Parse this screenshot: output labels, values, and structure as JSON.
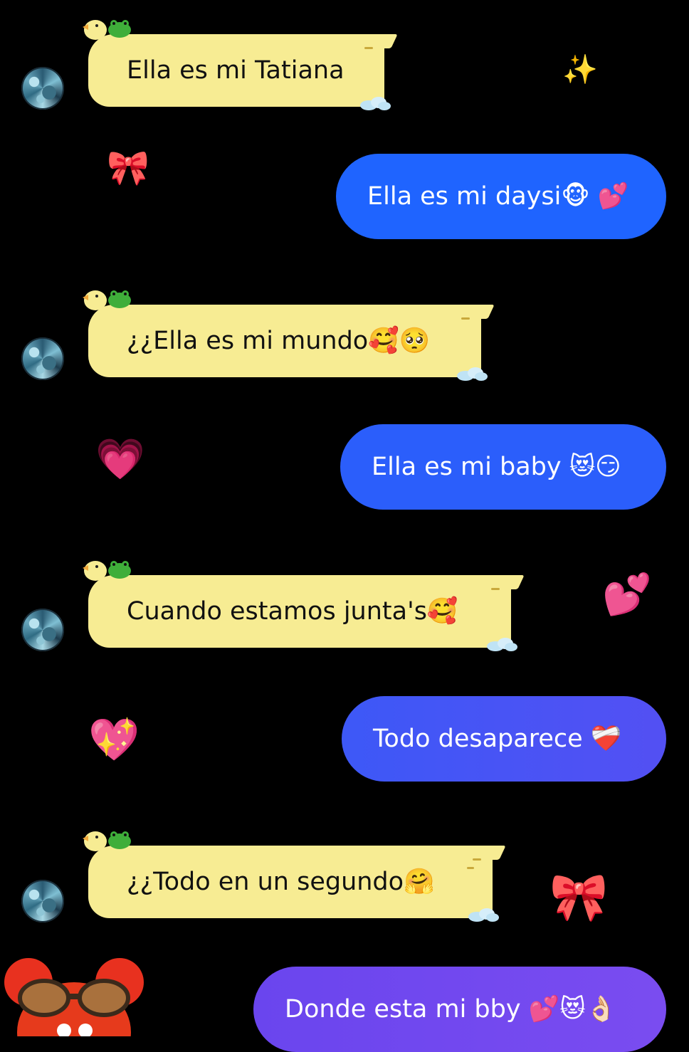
{
  "messages": [
    {
      "side": "incoming",
      "text": "Ella es mi Tatiana"
    },
    {
      "side": "outgoing",
      "text": "Ella es mi daysi🐵 💕"
    },
    {
      "side": "incoming",
      "text": "¿¿Ella es mi mundo🥰🥺"
    },
    {
      "side": "outgoing",
      "text": "Ella es mi baby 😻😏"
    },
    {
      "side": "incoming",
      "text": "Cuando estamos junta's🥰"
    },
    {
      "side": "outgoing",
      "text": "Todo desaparece ❤️‍🩹"
    },
    {
      "side": "incoming",
      "text": "¿¿Todo en un segundo🤗"
    },
    {
      "side": "outgoing",
      "text": "Donde esta mi bby 💕😻👌🏻"
    }
  ],
  "stickers": {
    "sparkles": "✨",
    "bow": "🎀",
    "heart_pulse": "💗",
    "hearts_two": "💕",
    "heart_sparkle": "💖",
    "bow2": "🎀"
  },
  "colors": {
    "incoming_bubble": "#f7ec93",
    "outgoing_top": "#1f64ff",
    "outgoing_bottom": "#7a4cf0",
    "background": "#000000"
  },
  "icons": {
    "avatar": "contact-avatar-icon",
    "duck": "duck-frog-theme-icon",
    "cloud": "cloud-icon",
    "profile": "red-monster-avatar-icon"
  }
}
